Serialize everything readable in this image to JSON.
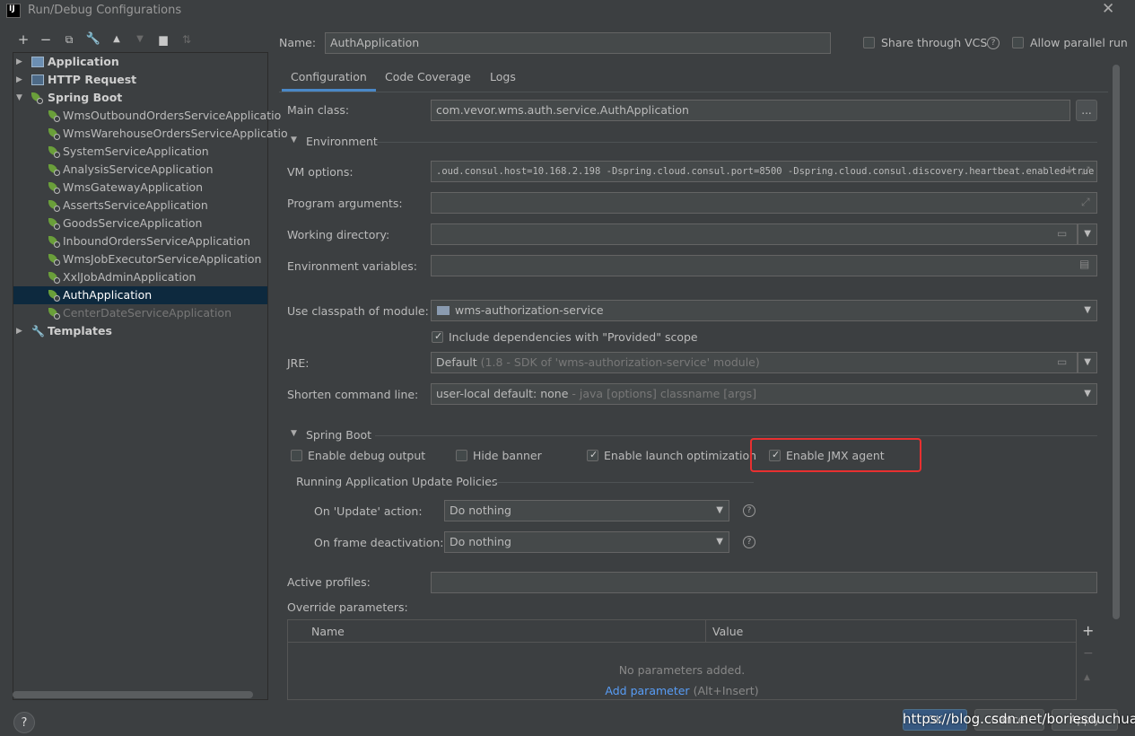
{
  "window": {
    "title": "Run/Debug Configurations",
    "logo": "IJ"
  },
  "left_toolbar": [
    "add-icon",
    "remove-icon",
    "copy-icon",
    "wrench-icon",
    "arrow-up-icon",
    "arrow-down-icon",
    "new-folder-icon",
    "sort-icon"
  ],
  "tree": {
    "groups": [
      {
        "label": "Application"
      },
      {
        "label": "HTTP Request"
      },
      {
        "label": "Spring Boot"
      }
    ],
    "spring_boot_items": [
      "WmsOutboundOrdersServiceApplicatio",
      "WmsWarehouseOrdersServiceApplicatio",
      "SystemServiceApplication",
      "AnalysisServiceApplication",
      "WmsGatewayApplication",
      "AssertsServiceApplication",
      "GoodsServiceApplication",
      "InboundOrdersServiceApplication",
      "WmsJobExecutorServiceApplication",
      "XxlJobAdminApplication",
      "AuthApplication",
      "CenterDateServiceApplication"
    ],
    "templates_label": "Templates"
  },
  "header": {
    "name_label": "Name:",
    "name_value": "AuthApplication",
    "share_vcs": "Share through VCS",
    "allow_parallel": "Allow parallel run"
  },
  "tabs": [
    "Configuration",
    "Code Coverage",
    "Logs"
  ],
  "config": {
    "main_class_label": "Main class:",
    "main_class_value": "com.vevor.wms.auth.service.AuthApplication",
    "browse_btn": "...",
    "environment_hdr": "Environment",
    "vm_options_label": "VM options:",
    "vm_options_value": ".oud.consul.host=10.168.2.198 -Dspring.cloud.consul.port=8500 -Dspring.cloud.consul.discovery.heartbeat.enabled=true",
    "program_args_label": "Program arguments:",
    "working_dir_label": "Working directory:",
    "env_vars_label": "Environment variables:",
    "classpath_label": "Use classpath of module:",
    "classpath_value": "wms-authorization-service",
    "include_deps": "Include dependencies with \"Provided\" scope",
    "jre_label": "JRE:",
    "jre_value": "Default",
    "jre_hint": "(1.8 - SDK of 'wms-authorization-service' module)",
    "shorten_label": "Shorten command line:",
    "shorten_value": "user-local default: none",
    "shorten_hint": "- java [options] classname [args]"
  },
  "spring_boot": {
    "hdr": "Spring Boot",
    "enable_debug": "Enable debug output",
    "hide_banner": "Hide banner",
    "enable_launch_opt": "Enable launch optimization",
    "enable_jmx": "Enable JMX agent",
    "policies_hdr": "Running Application Update Policies",
    "on_update_label": "On 'Update' action:",
    "on_update_value": "Do nothing",
    "on_frame_label": "On frame deactivation:",
    "on_frame_value": "Do nothing",
    "active_profiles_label": "Active profiles:",
    "override_label": "Override parameters:",
    "col_name": "Name",
    "col_value": "Value",
    "empty_text": "No parameters added.",
    "add_param_link": "Add parameter",
    "add_param_hint": "(Alt+Insert)"
  },
  "footer": {
    "watermark": "https://blog.csdn.net/boriesduchuan",
    "ok": "OK",
    "cancel": "Cancel",
    "apply": "Apply"
  },
  "colors": {
    "selection": "#0d293e",
    "accent": "#4a88c7",
    "highlight_box": "#e83030",
    "link": "#589df6"
  }
}
